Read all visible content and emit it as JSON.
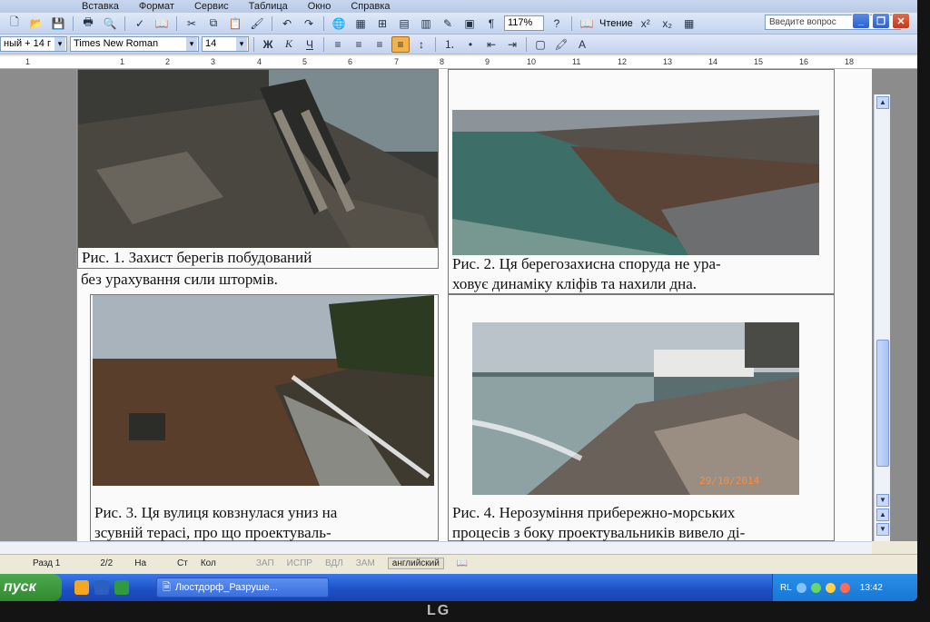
{
  "menu": {
    "items": [
      "Вставка",
      "Формат",
      "Сервис",
      "Таблица",
      "Окно",
      "Справка"
    ]
  },
  "toolbar": {
    "zoom": "117%",
    "reading_label": "Чтение",
    "help_placeholder": "Введите вопрос"
  },
  "format_bar": {
    "style": "ный + 14 г",
    "font": "Times New Roman",
    "size": "14",
    "bold_label": "Ж",
    "italic_label": "К",
    "underline_label": "Ч"
  },
  "ruler": {
    "labels": [
      "1",
      "1",
      "2",
      "3",
      "4",
      "5",
      "6",
      "7",
      "8",
      "9",
      "10",
      "11",
      "12",
      "13",
      "14",
      "15",
      "16",
      "18"
    ]
  },
  "figures": [
    {
      "caption_line1": "Рис. 1. Захист берегів побудований",
      "caption_line2": "без урахування сили штормів."
    },
    {
      "caption_line1": "Рис. 2. Ця берегозахисна споруда не ура-",
      "caption_line2": "ховує динаміку кліфів та нахили дна."
    },
    {
      "caption_line1": "Рис. 3. Ця вулиця ковзнулася униз на",
      "caption_line2": "зсувній терасі, про що проектуваль-"
    },
    {
      "caption_line1": "Рис. 4. Нерозуміння прибережно-морських",
      "caption_line2": "процесів з боку проектувальників вивело ді-",
      "date_stamp": "29/10/2014"
    }
  ],
  "statusbar": {
    "section": "Разд  1",
    "pages": "2/2",
    "at": "На",
    "line": "Ст",
    "col": "Кол",
    "rec": "ЗАП",
    "trk": "ИСПР",
    "ext": "ВДЛ",
    "ovr": "ЗАМ",
    "language": "английский"
  },
  "taskbar": {
    "start_label": "пуск",
    "task_label": "Люстдорф_Разруше...",
    "tray_lang": "RL",
    "clock": "13:42"
  },
  "monitor": {
    "brand": "LG"
  },
  "colors": {
    "taskbar_blue": "#1c4fc4",
    "start_green": "#2f8a2f",
    "toolbar_bg": "#c3d3ef"
  }
}
